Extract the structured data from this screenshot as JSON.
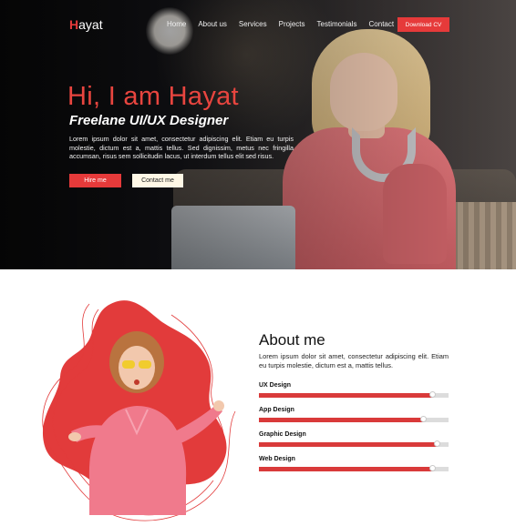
{
  "nav": {
    "logo_initial": "H",
    "logo_rest": "ayat",
    "items": [
      "Home",
      "About us",
      "Services",
      "Projects",
      "Testimonials",
      "Contact"
    ],
    "cta_label": "Download CV"
  },
  "hero": {
    "title": "Hi, I am Hayat",
    "subtitle": "Freelane UI/UX Designer",
    "text": "Lorem ipsum dolor sit amet, consectetur adipiscing elit. Etiam eu turpis molestie, dictum est a, mattis tellus. Sed dignissim, metus nec fringilla accumsan, risus sem sollicitudin lacus, ut interdum tellus elit sed risus.",
    "hire_label": "Hire me",
    "contact_label": "Contact me"
  },
  "about": {
    "title": "About me",
    "text": "Lorem ipsum dolor sit amet, consectetur adipiscing elit. Etiam eu turpis molestie, dictum est a, mattis tellus.",
    "skills": [
      {
        "label": "UX Design",
        "level": 0.92
      },
      {
        "label": "App Design",
        "level": 0.87
      },
      {
        "label": "Graphic Design",
        "level": 0.94
      },
      {
        "label": "Web Design",
        "level": 0.92
      }
    ]
  },
  "colors": {
    "accent": "#e63a3a",
    "hero_bg": "#16161a",
    "contact_button_bg": "#fff8e6"
  }
}
